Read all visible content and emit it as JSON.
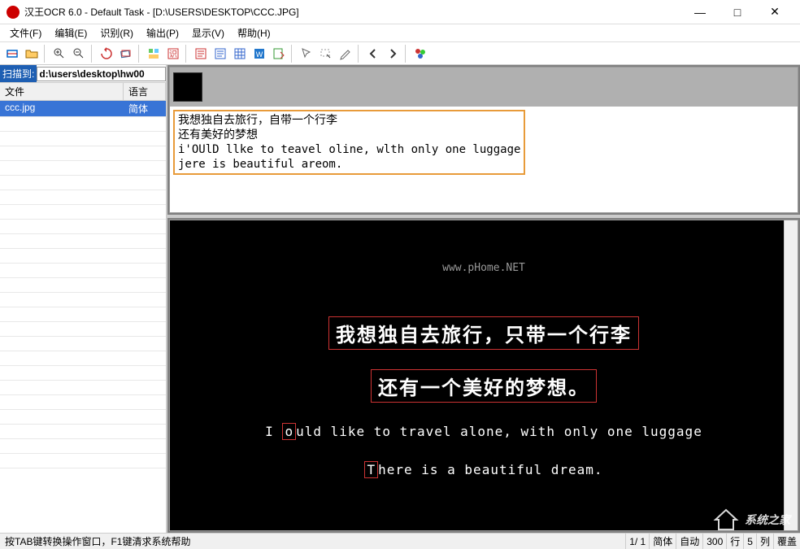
{
  "titlebar": {
    "title": "汉王OCR 6.0 - Default Task - [D:\\USERS\\DESKTOP\\CCC.JPG]"
  },
  "menu": {
    "file": "文件(F)",
    "edit": "编辑(E)",
    "recognize": "识别(R)",
    "output": "输出(P)",
    "display": "显示(V)",
    "help": "帮助(H)"
  },
  "sidebar": {
    "scan_label": "扫描到:",
    "scan_path": "d:\\users\\desktop\\hw00",
    "col_file": "文件",
    "col_lang": "语言",
    "rows": [
      {
        "file": "ccc.jpg",
        "lang": "简体"
      }
    ]
  },
  "ocr_text": {
    "line1": "我想独自去旅行，自带一个行李",
    "line2": "还有美好的梦想",
    "line3": "i'OUlD llke to teavel oline, wlth only one luggage",
    "line4": "jere is  beautiful areom."
  },
  "image_view": {
    "watermark": "www.pHome.NET",
    "line1": "我想独自去旅行，只带一个行李",
    "line2": "还有一个美好的梦想。",
    "line3_pre": "I",
    "line3_box": "o",
    "line3_post": "uld like to travel alone, with only one luggage",
    "line4_box": "T",
    "line4_post": "here is a beautiful dream."
  },
  "statusbar": {
    "help": "按TAB键转换操作窗口，F1键清求系统帮助",
    "page": "1/    1",
    "simp": "简体",
    "auto": "自动",
    "dpi": "300",
    "row": "行",
    "col_num": "5",
    "col": "列",
    "overwrite": "覆盖"
  },
  "logo_text": "系统之家"
}
